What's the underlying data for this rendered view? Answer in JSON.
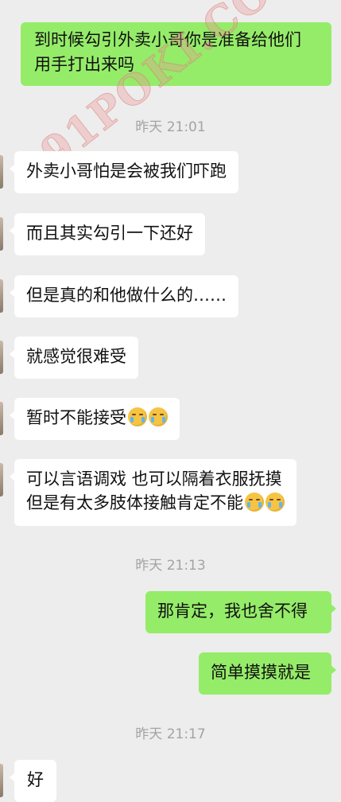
{
  "colors": {
    "background": "#ededed",
    "outgoing_bubble": "#95ec69",
    "incoming_bubble": "#ffffff",
    "timestamp": "#a3a3a3"
  },
  "watermark": "91POKI.COM",
  "messages": [
    {
      "side": "out",
      "lines": [
        "到时候勾引外卖小哥你是准备给他们",
        "用手打出来吗"
      ]
    },
    {
      "type": "time",
      "text": "昨天 21:01"
    },
    {
      "side": "in",
      "text": "外卖小哥怕是会被我们吓跑"
    },
    {
      "side": "in",
      "text": "而且其实勾引一下还好"
    },
    {
      "side": "in",
      "text": "但是真的和他做什么的……"
    },
    {
      "side": "in",
      "text": "就感觉很难受"
    },
    {
      "side": "in",
      "text": "暂时不能接受",
      "emojis": [
        "face-with-tears-emoji",
        "face-with-tears-emoji"
      ]
    },
    {
      "side": "in",
      "lines": [
        "可以言语调戏 也可以隔着衣服抚摸",
        "但是有太多肢体接触肯定不能"
      ],
      "emojis": [
        "face-with-tears-emoji",
        "face-with-tears-emoji"
      ]
    },
    {
      "type": "time",
      "text": "昨天 21:13"
    },
    {
      "side": "out",
      "text": "那肯定，我也舍不得"
    },
    {
      "side": "out",
      "text": "简单摸摸就是"
    },
    {
      "type": "time",
      "text": "昨天 21:17"
    },
    {
      "side": "in",
      "text": "好"
    }
  ]
}
